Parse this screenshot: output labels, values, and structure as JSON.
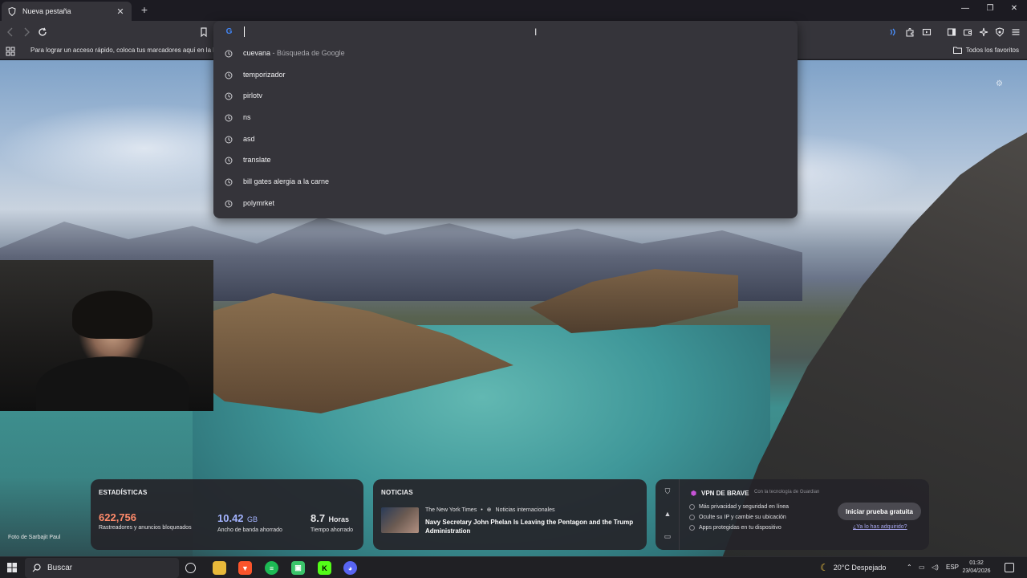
{
  "browser": {
    "tab_title": "Nueva pestaña",
    "new_tab": "+",
    "bookmarks_hint": "Para lograr un acceso rápido, coloca tus marcadores aquí en la barra de marcadores.",
    "all_bookmarks": "Todos los favoritos"
  },
  "omnibox": {
    "value": "",
    "suggestions": [
      {
        "text": "cuevana",
        "sub": " - Búsqueda de Google"
      },
      {
        "text": "temporizador",
        "sub": ""
      },
      {
        "text": "pirlotv",
        "sub": ""
      },
      {
        "text": "ns",
        "sub": ""
      },
      {
        "text": "asd",
        "sub": ""
      },
      {
        "text": "translate",
        "sub": ""
      },
      {
        "text": "bill gates alergia a la carne",
        "sub": ""
      },
      {
        "text": "polymrket",
        "sub": ""
      }
    ]
  },
  "page": {
    "photo_credit": "Foto de Sarbajit Paul"
  },
  "stats": {
    "title": "ESTADÍSTICAS",
    "trackers_value": "622,756",
    "trackers_label": "Rastreadores y anuncios bloqueados",
    "bandwidth_value": "10.42",
    "bandwidth_unit": "GB",
    "bandwidth_label": "Ancho de banda ahorrado",
    "time_value": "8.7",
    "time_unit": "Horas",
    "time_label": "Tiempo ahorrado",
    "colors": {
      "trackers": "#ff8a6a",
      "bandwidth": "#a4b4ff",
      "time": "#ffffff"
    }
  },
  "news": {
    "title": "NOTICIAS",
    "source": "The New York Times",
    "category": "Noticias internacionales",
    "headline": "Navy Secretary John Phelan Is Leaving the Pentagon and the Trump Administration"
  },
  "vpn": {
    "title": "VPN DE BRAVE",
    "powered_by": "Con la tecnología de Guardian",
    "features": [
      "Más privacidad y seguridad en línea",
      "Oculte su IP y cambie su ubicación",
      "Apps protegidas en tu dispositivo"
    ],
    "cta": "Iniciar prueba gratuita",
    "already": "¿Ya lo has adquirido?"
  },
  "taskbar": {
    "search_placeholder": "Buscar",
    "weather": "20°C  Despejado",
    "lang": "ESP",
    "time": "01:32",
    "date": "23/04/2026"
  },
  "icons": [
    "brave-shield-icon",
    "close-icon",
    "back-icon",
    "forward-icon",
    "reload-icon",
    "bookmark-icon",
    "google-icon",
    "history-icon",
    "extensions-icon",
    "wallet-icon",
    "sidebar-icon",
    "leo-icon",
    "menu-icon",
    "apps-grid-icon",
    "folder-icon",
    "windows-start-icon",
    "search-icon",
    "file-explorer-icon",
    "brave-icon",
    "spotify-icon",
    "discord-icon"
  ]
}
